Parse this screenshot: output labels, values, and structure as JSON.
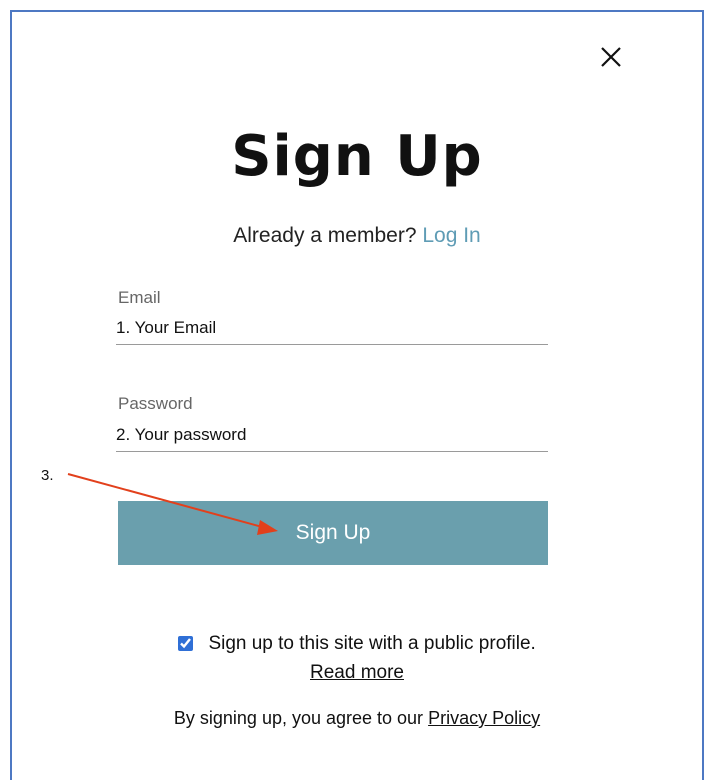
{
  "dialog": {
    "title": "Sign Up",
    "already_member_text": "Already a member?",
    "login_link": "Log In",
    "close_icon": "close-icon"
  },
  "form": {
    "email_label": "Email",
    "email_value": "1. Your Email",
    "password_label": "Password",
    "password_value": "2. Your password",
    "submit_label": "Sign Up"
  },
  "annotations": {
    "step_three": "3.",
    "arrow_color": "#e2401c"
  },
  "profile_option": {
    "checked": true,
    "label": "Sign up to this site with a public profile.",
    "read_more": "Read more"
  },
  "legal": {
    "prefix": "By signing up, you agree to our",
    "privacy_link": "Privacy Policy"
  },
  "colors": {
    "button_bg": "#6a9fad",
    "link": "#5f9cb5",
    "frame_border": "#4d78c3"
  }
}
